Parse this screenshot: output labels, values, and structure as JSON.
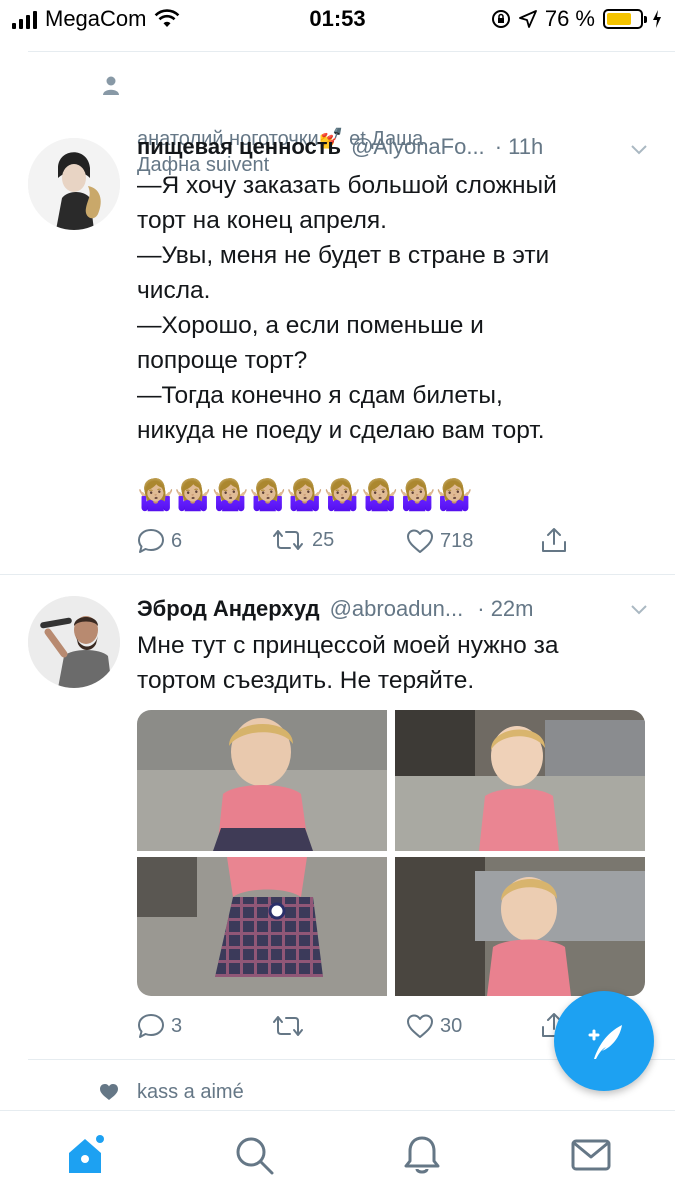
{
  "status_bar": {
    "carrier": "MegaCom",
    "time": "01:53",
    "battery": "76 %",
    "battery_level": 0.76
  },
  "tweets": [
    {
      "context": "анатолий ноготочки💅 et Даша\nДафна suivent",
      "context_icon": "person-icon",
      "name": "пищевая ценность",
      "handle": "@AlyonaFo...",
      "time": "· 11h",
      "text": "—Я хочу заказать большой сложный\nторт на конец апреля.\n—Увы, меня не будет в стране в эти\nчисла.\n—Хорошо, а если поменьше и\nпопроще торт?\n—Тогда конечно я сдам билеты,\nникуда не поеду и сделаю вам торт.",
      "emoji": "🤷🏼‍♀️🤷🏼‍♀️🤷🏼‍♀️🤷🏼‍♀️🤷🏼‍♀️🤷🏼‍♀️🤷🏼‍♀️🤷🏼‍♀️🤷🏼‍♀️",
      "replies": "6",
      "retweets": "25",
      "likes": "718"
    },
    {
      "name": "Эброд Андерхуд",
      "handle": "@abroadun...",
      "time": "· 22m",
      "text": "Мне тут с принцессой моей нужно за\nтортом съездить. Не теряйте.",
      "replies": "3",
      "retweets": "",
      "likes": "30"
    }
  ],
  "third_context": {
    "text": "kass a aimé",
    "icon": "heart-icon"
  },
  "colors": {
    "accent": "#1da1f2",
    "muted": "#657786",
    "text": "#14171a",
    "divider": "#e6ecf0"
  },
  "tabbar": [
    "home-icon",
    "search-icon",
    "notifications-icon",
    "messages-icon"
  ]
}
